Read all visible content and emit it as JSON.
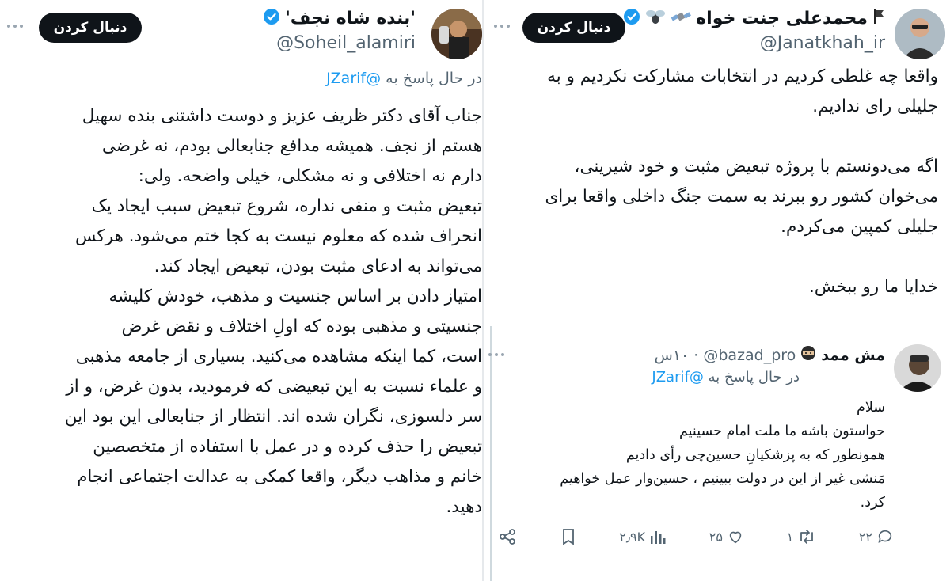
{
  "left_tweet": {
    "display_name": "'بنده شاه نجف'",
    "handle": "@Soheil_alamiri",
    "follow_label": "دنبال کردن",
    "replying_prefix": "در حال پاسخ به",
    "replying_mention": "@JZarif",
    "body_lines": [
      "جناب آقای دکتر ظریف عزیز و دوست داشتنی بنده سهیل",
      "هستم از نجف. همیشه مدافع جنابعالی بودم، نه غرضی",
      "دارم نه اختلافی و نه مشکلی، خیلی واضحه. ولی:",
      "تبعیض مثبت و منفی نداره، شروع تبعیض سبب ایجاد یک",
      "انحراف شده که معلوم نیست به کجا ختم می‌شود. هرکس",
      "می‌تواند به ادعای مثبت بودن، تبعیض ایجاد کند.",
      "امتیاز دادن بر اساس جنسیت و مذهب، خودش کلیشه",
      "جنسیتی و مذهبی بوده که اولِ اختلاف و نقض غرض",
      "است، کما اینکه مشاهده می‌کنید. بسیاری از جامعه مذهبی",
      "و علماء نسبت به این تبعیضی که فرمودید، بدون غرض، و از",
      "سر دلسوزی، نگران شده اند. انتظار از جنابعالی این بود این",
      "تبعیض را حذف کرده و در عمل با استفاده از متخصصین",
      "خانم و مذاهب دیگر، واقعا کمکی به عدالت اجتماعی انجام",
      "دهید."
    ]
  },
  "right_tweet": {
    "display_name": "محمدعلی جنت خواه",
    "handle": "@Janatkhah_ir",
    "follow_label": "دنبال کردن",
    "paragraphs": [
      [
        "واقعا چه غلطی کردیم در انتخابات مشارکت نکردیم و به",
        "جلیلی رای ندادیم."
      ],
      [
        "اگه می‌دونستم با پروژه تبعیض مثبت و خود شیرینی،",
        "می‌خوان کشور رو ببرند به سمت جنگ داخلی واقعا برای",
        "جلیلی کمپین می‌کردم."
      ],
      [
        "خدایا ما رو ببخش."
      ]
    ]
  },
  "reply_tweet": {
    "display_name": "مش ممد",
    "handle": "@bazad_pro",
    "time": "۱۰س",
    "replying_prefix": "در حال پاسخ به",
    "replying_mention": "@JZarif",
    "body_lines": [
      "سلام",
      "حواستون باشه ما ملت امام حسینیم",
      "همونطور که به پزشکیانِ حسین‌چی رأی دادیم",
      "مَنشی غیر از این در دولت ببینیم ، حسین‌وار عمل خواهیم",
      "کرد."
    ],
    "stats": {
      "replies": "۲۲",
      "reposts": "۱",
      "likes": "۲۵",
      "views": "۲٫۹K"
    }
  },
  "colors": {
    "verified": "#1d9bf0",
    "mention": "#1d9bf0",
    "secondary_text": "#536471",
    "follow_button": "#0f1419"
  }
}
